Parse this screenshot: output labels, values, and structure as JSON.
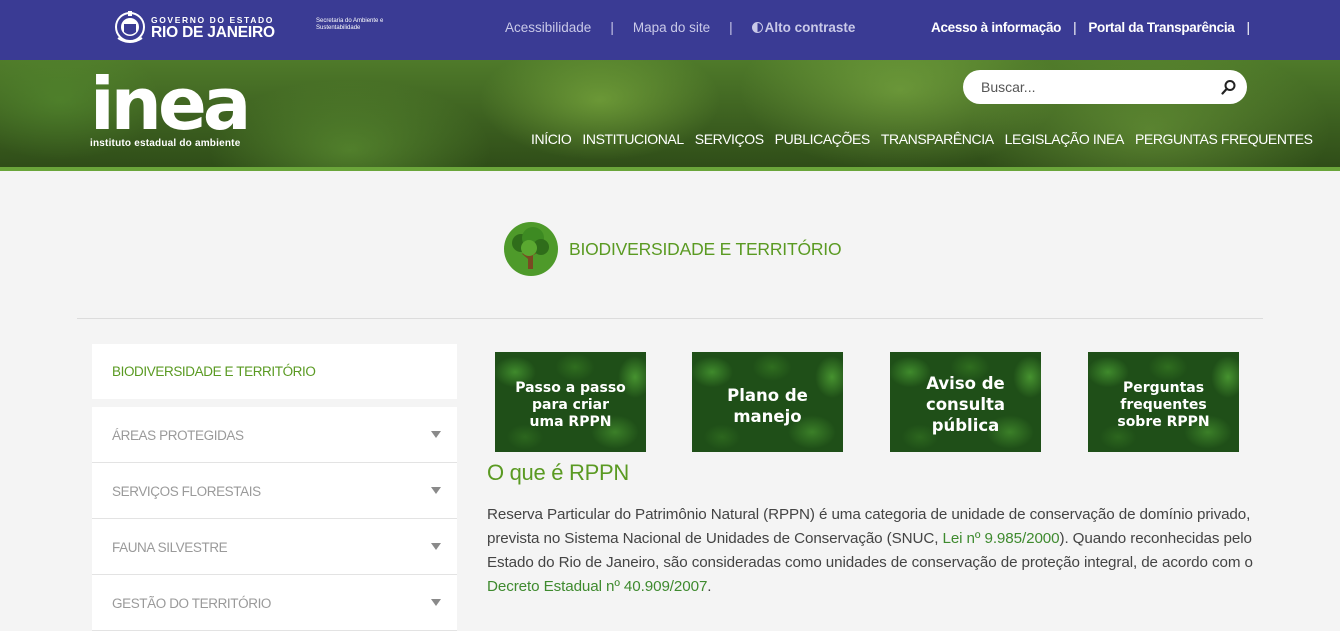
{
  "gov": {
    "line1": "GOVERNO DO ESTADO",
    "line2": "RIO DE JANEIRO",
    "secretaria": "Secretaria do Ambiente e Sustentabilidade",
    "links": [
      "Acessibilidade",
      "Mapa do site",
      "Alto contraste"
    ],
    "right_links": [
      "Acesso à informação",
      "Portal da Transparência"
    ],
    "separator": "|"
  },
  "brand": {
    "name": "inea",
    "subtitle": "instituto estadual do ambiente"
  },
  "search": {
    "placeholder": "Buscar..."
  },
  "nav": [
    "INÍCIO",
    "INSTITUCIONAL",
    "SERVIÇOS",
    "PUBLICAÇÕES",
    "TRANSPARÊNCIA",
    "LEGISLAÇÃO INEA",
    "PERGUNTAS FREQUENTES"
  ],
  "section": {
    "title": "BIODIVERSIDADE E TERRITÓRIO"
  },
  "sidebar": {
    "active": "BIODIVERSIDADE E TERRITÓRIO",
    "items": [
      "ÁREAS PROTEGIDAS",
      "SERVIÇOS FLORESTAIS",
      "FAUNA SILVESTRE",
      "GESTÃO DO TERRITÓRIO"
    ]
  },
  "tiles": [
    "Passo a passo\npara criar\numa RPPN",
    "Plano de\nmanejo",
    "Aviso de\nconsulta\npública",
    "Perguntas\nfrequentes\nsobre RPPN"
  ],
  "content": {
    "title": "O que é RPPN",
    "p1": "Reserva Particular do Patrimônio Natural (RPPN) é uma categoria de unidade de conservação de domínio privado, prevista no Sistema Nacional de Unidades de Conservação (SNUC, ",
    "link1": "Lei nº 9.985/2000",
    "p2": "). Quando reconhecidas pelo Estado do Rio de Janeiro, são consideradas como unidades de conservação de proteção integral, de acordo com o ",
    "link2": "Decreto Estadual nº 40.909/2007",
    "p3": "."
  },
  "colors": {
    "gov_bar": "#3a3b94",
    "accent_green": "#5a9a22",
    "link_green": "#3e8a2e"
  }
}
